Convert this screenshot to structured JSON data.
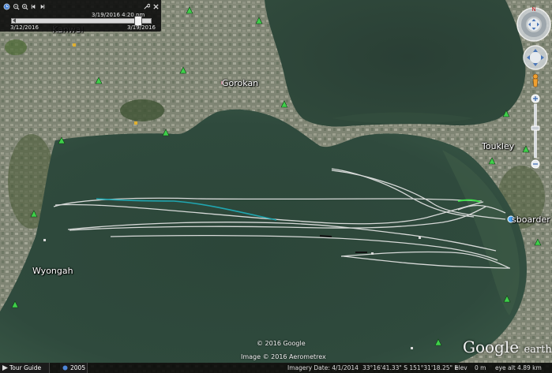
{
  "timebar": {
    "current_time": "3/19/2016   4:20 pm",
    "start_date": "3/12/2016",
    "end_date": "3/19/2016"
  },
  "places": [
    {
      "key": "kanwal",
      "name": "Kanwal"
    },
    {
      "key": "gorokan",
      "name": "Gorokan"
    },
    {
      "key": "toukley",
      "name": "Toukley"
    },
    {
      "key": "wyongah",
      "name": "Wyongah"
    },
    {
      "key": "boarder",
      "name": "sboarder"
    }
  ],
  "credits": {
    "copyright": "© 2016 Google",
    "imagery": "Image © 2016 Aerometrex"
  },
  "logo": {
    "main": "Google",
    "suffix": "earth"
  },
  "statusbar": {
    "tour_guide": "Tour Guide",
    "year": "2005",
    "imagery_date": "Imagery Date: 4/1/2014",
    "coords": "33°16'41.33\" S  151°31'18.25\" E",
    "elev_label": "elev",
    "elev_value": "0 m",
    "eye_alt": "eye alt   4.89 km"
  },
  "colors": {
    "water": "#2f4a3f",
    "track": "#e6e6e6",
    "highlight_cyan": "#20a6b0",
    "highlight_green": "#3ee04a",
    "poi_green": "#3fcf4a"
  }
}
